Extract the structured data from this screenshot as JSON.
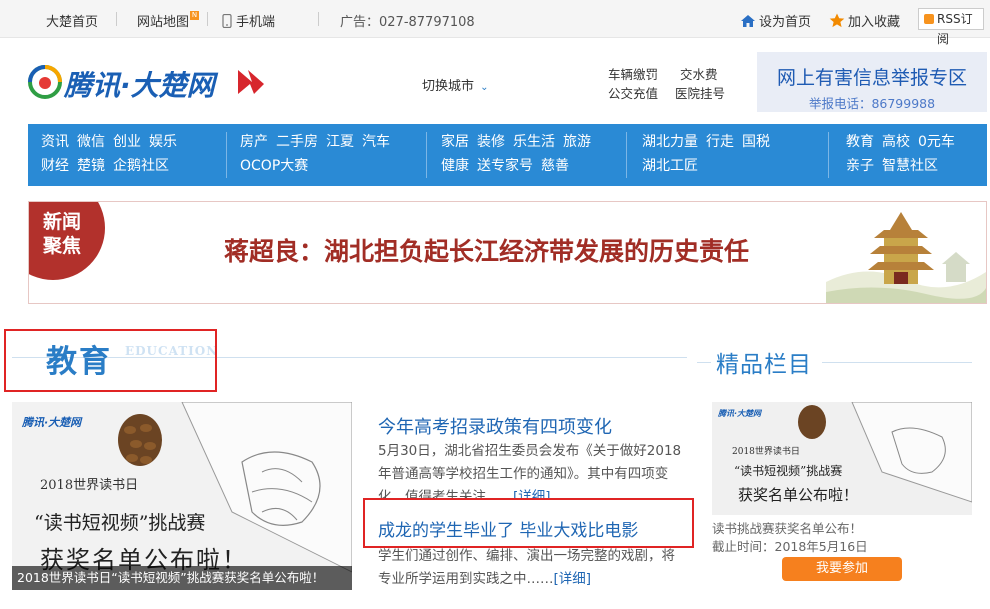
{
  "topbar": {
    "home": "大楚首页",
    "sitemap": "网站地图",
    "new_badge": "N",
    "mobile": "手机端",
    "ad": "广告：027-87797108",
    "set_home": "设为首页",
    "favorite": "加入收藏",
    "rss": "RSS订阅"
  },
  "header": {
    "logo": "腾讯·大楚网",
    "city_switch": "切换城市",
    "quick_links": [
      "车辆缴罚",
      "交水费",
      "公交充值",
      "医院挂号"
    ],
    "report_title": "网上有害信息举报专区",
    "report_phone": "举报电话：86799988"
  },
  "nav": {
    "col1": {
      "row1": [
        "资讯",
        "微信",
        "创业",
        "娱乐"
      ],
      "row2": [
        "财经",
        "楚镜",
        "企鹅社区"
      ]
    },
    "col2": {
      "row1": [
        "房产",
        "二手房",
        "江夏",
        "汽车"
      ],
      "row2": [
        "OCOP大赛"
      ]
    },
    "col3": {
      "row1": [
        "家居",
        "装修",
        "乐生活",
        "旅游"
      ],
      "row2": [
        "健康",
        "送专家号",
        "慈善"
      ]
    },
    "col4": {
      "row1": [
        "湖北力量",
        "行走",
        "国税"
      ],
      "row2": [
        "湖北工匠"
      ]
    },
    "col5": {
      "row1": [
        "教育",
        "高校",
        "0元车"
      ],
      "row2": [
        "亲子",
        "智慧社区"
      ]
    }
  },
  "banner": {
    "tag_line1": "新闻",
    "tag_line2": "聚焦",
    "headline": "蒋超良：湖北担负起长江经济带发展的历史责任"
  },
  "education": {
    "title": "教育",
    "title_en": "EDUCATION",
    "image": {
      "logo": "腾讯·大楚网",
      "line1": "2018世界读书日",
      "line2": "“读书短视频”挑战赛",
      "line3": "获奖名单公布啦！",
      "caption": "2018世界读书日“读书短视频”挑战赛获奖名单公布啦！"
    },
    "articles": [
      {
        "title": "今年高考招录政策有四项变化",
        "summary": "5月30日，湖北省招生委员会发布《关于做好2018年普通高等学校招生工作的通知》。其中有四项变化，值得考生关注……",
        "more": "[详细]"
      },
      {
        "title": "成龙的学生毕业了 毕业大戏比电影",
        "summary": "学生们通过创作、编排、演出一场完整的戏剧，将专业所学运用到实践之中……",
        "more": "[详细]"
      }
    ]
  },
  "featured": {
    "title": "精品栏目",
    "image": {
      "logo": "腾讯·大楚网",
      "line1": "2018世界读书日",
      "line2": "“读书短视频”挑战赛",
      "line3": "获奖名单公布啦！"
    },
    "desc": "读书挑战赛获奖名单公布！",
    "deadline": "截止时间：2018年5月16日",
    "button": "我要参加"
  },
  "colors": {
    "nav_bg": "#2a8ad5",
    "brand_blue": "#1a5fb4",
    "banner_red": "#b2312c",
    "highlight_red": "#e02424",
    "button_orange": "#f6801e"
  }
}
